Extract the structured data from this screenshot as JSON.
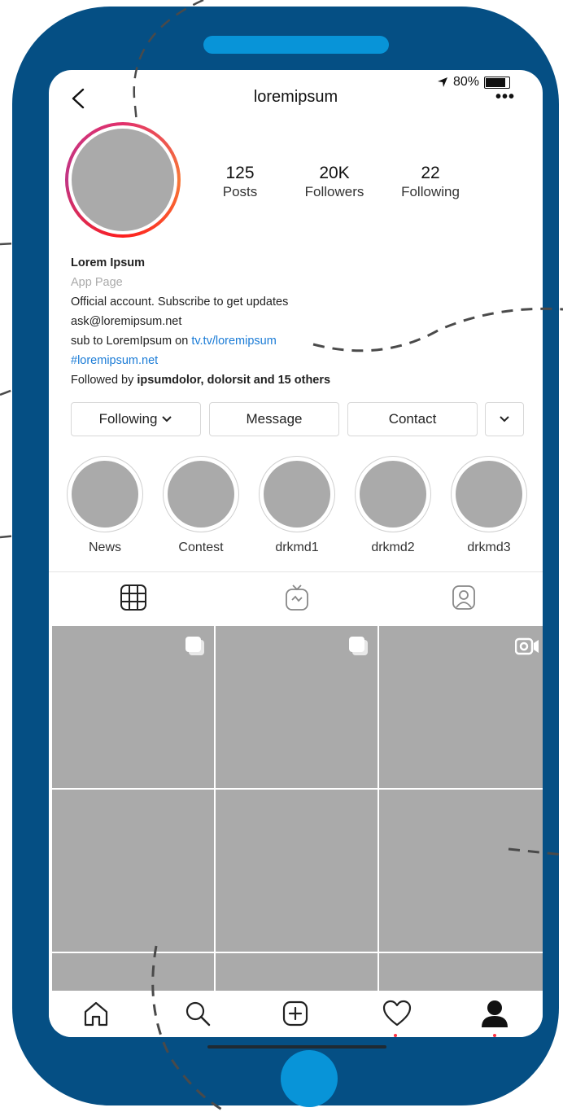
{
  "colors": {
    "phone_body": "#054f84",
    "accent_blue": "#0894d8",
    "placeholder_gray": "#aaaaaa",
    "link_blue": "#1a7bd6"
  },
  "status_bar": {
    "battery": "80%",
    "location_icon": "location-arrow-icon"
  },
  "header": {
    "username": "loremipsum",
    "back_icon": "chevron-left-icon",
    "more_icon": "more-dots-icon"
  },
  "stats": [
    {
      "value": "125",
      "label": "Posts"
    },
    {
      "value": "20K",
      "label": "Followers"
    },
    {
      "value": "22",
      "label": "Following"
    }
  ],
  "bio": {
    "name": "Lorem Ipsum",
    "category": "App Page",
    "line1": "Official account. Subscribe to get updates",
    "email": "ask@loremipsum.net",
    "sub_prefix": "sub to LoremIpsum on ",
    "sub_link": "tv.tv/loremipsum",
    "hashtag": "#loremipsum.net",
    "followed_prefix": "Followed by ",
    "followed_names": "ipsumdolor, dolorsit and 15 others"
  },
  "actions": {
    "following": "Following",
    "message": "Message",
    "contact": "Contact"
  },
  "highlights": [
    "News",
    "Contest",
    "drkmd1",
    "drkmd2",
    "drkmd3"
  ],
  "tabs": [
    "grid-icon",
    "igtv-icon",
    "tagged-icon"
  ],
  "nav": [
    "home-icon",
    "search-icon",
    "add-post-icon",
    "heart-icon",
    "profile-icon"
  ]
}
